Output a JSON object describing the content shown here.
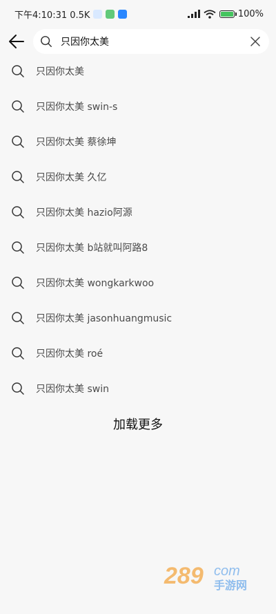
{
  "status_bar": {
    "time_network": "下午4:10:31 0.5K",
    "battery_text": "100%",
    "battery_level": 1.0
  },
  "search": {
    "query": "只因你太美"
  },
  "suggestions": [
    "只因你太美",
    "只因你太美 swin-s",
    "只因你太美 蔡徐坤",
    "只因你太美 久亿",
    "只因你太美 hazio阿源",
    "只因你太美 b站就叫阿路8",
    "只因你太美 wongkarkwoo",
    "只因你太美 jasonhuangmusic",
    "只因你太美 roé",
    "只因你太美 swin"
  ],
  "load_more_label": "加载更多",
  "watermark": {
    "number_text": "289",
    "domain_text": "com",
    "site_text": "手游网"
  },
  "icons": {
    "back": "arrow-left-icon",
    "search": "search-icon",
    "clear": "close-icon"
  },
  "colors": {
    "background": "#f7f7f7",
    "search_box": "#ffffff",
    "text_primary": "#111111",
    "text_secondary": "#4a4a4a",
    "battery_fill": "#44c45e",
    "watermark_orange": "#f39a26",
    "watermark_blue": "#3a8ee6"
  }
}
